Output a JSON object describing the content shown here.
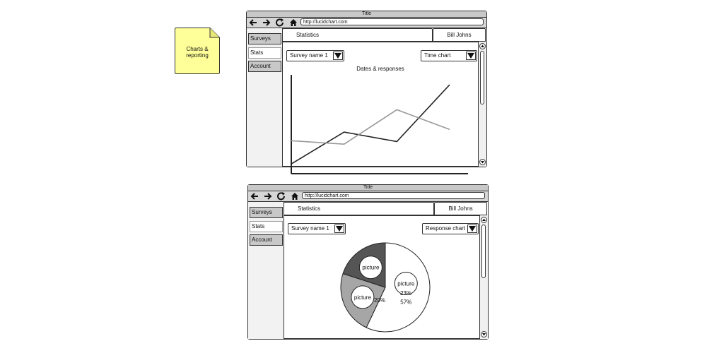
{
  "note": {
    "text": "Charts & reporting"
  },
  "windows": [
    {
      "title": "Title",
      "url": "http://lucidchart.com",
      "sidebar": [
        {
          "label": "Surveys",
          "state": "inactive"
        },
        {
          "label": "Stats",
          "state": "active"
        },
        {
          "label": "Account",
          "state": "inactive"
        }
      ],
      "tabs": [
        "Statistics",
        "Bill Johns"
      ],
      "dropdowns": {
        "survey": "Survey name 1",
        "chart": "Time chart"
      },
      "chart_title": "Dates & responses",
      "chart_data": {
        "type": "line",
        "title": "Dates & responses",
        "xlabel": "",
        "ylabel": "",
        "x": [
          1,
          2,
          3,
          4
        ],
        "grid": false,
        "series": [
          {
            "color": "#222222",
            "values": [
              8,
              45,
              34,
              100
            ]
          },
          {
            "color": "#999999",
            "values": [
              35,
              31,
              71,
              48
            ]
          }
        ]
      }
    },
    {
      "title": "Title",
      "url": "http://lucidchart.com",
      "sidebar": [
        {
          "label": "Surveys",
          "state": "inactive"
        },
        {
          "label": "Stats",
          "state": "active"
        },
        {
          "label": "Account",
          "state": "inactive"
        }
      ],
      "tabs": [
        "Statistics",
        "Bill Johns"
      ],
      "dropdowns": {
        "survey": "Survey name 1",
        "chart": "Response chart"
      },
      "chart_data": {
        "type": "pie",
        "slices": [
          {
            "label": "57%",
            "value": 57,
            "color": "#ffffff",
            "picture": "picture"
          },
          {
            "label": "23%",
            "value": 23,
            "color": "#a6a6a6",
            "picture": "picture"
          },
          {
            "label": "20%",
            "value": 20,
            "color": "#555555",
            "picture": "picture"
          }
        ]
      }
    }
  ]
}
